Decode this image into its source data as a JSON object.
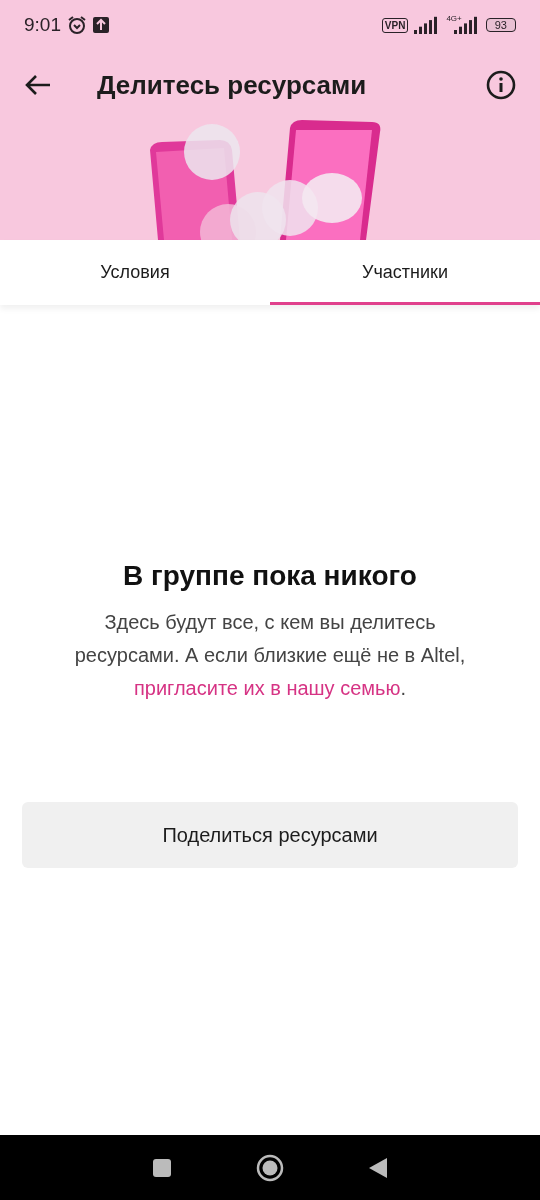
{
  "status_bar": {
    "time": "9:01",
    "vpn": "VPN",
    "network": "4G+",
    "battery": "93"
  },
  "header": {
    "title": "Делитесь ресурсами"
  },
  "tabs": [
    {
      "label": "Условия",
      "selected": false
    },
    {
      "label": "Участники",
      "selected": true
    }
  ],
  "empty_state": {
    "title": "В группе пока никого",
    "text_before": "Здесь будут все, с кем вы делитесь ресурсами. А если близкие ещё не в Altel, ",
    "link": "пригласите их в нашу семью",
    "text_after": "."
  },
  "action_button": "Поделиться ресурсами"
}
